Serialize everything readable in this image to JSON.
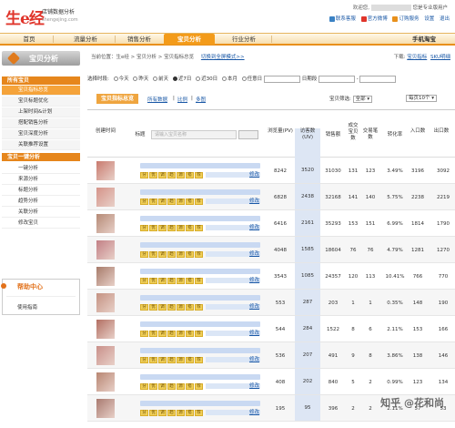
{
  "header": {
    "logo_main": "生e经",
    "logo_sub": "店铺数据分析",
    "logo_url": "shengejing.com",
    "greeting": "欢迎您,",
    "edition": "您是专业版用户",
    "links": [
      "联系客服",
      "官方微博",
      "订购服务",
      "设置",
      "退出"
    ]
  },
  "nav": [
    "首页",
    "流量分析",
    "销售分析",
    "宝贝分析",
    "行业分析",
    "手机淘宝"
  ],
  "nav_active": 3,
  "sidebar": {
    "title": "宝贝分析",
    "group1": "所有宝贝",
    "group1_items": [
      "宝贝指标总览",
      "宝贝标题优化",
      "上架时间&计划",
      "搭配销售分析",
      "宝贝深度分析",
      "关联推荐设置"
    ],
    "group2": "宝贝一键分析",
    "group2_items": [
      "一键分析",
      "来源分析",
      "标题分析",
      "趋势分析",
      "关联分析",
      "修改宝贝"
    ],
    "help_title": "帮助中心",
    "help_link": "使用指南"
  },
  "breadcrumb": {
    "text": "当前位置：生e经 > 宝贝分析 > 宝贝指标总览",
    "link": "切换到全屏模式>>",
    "right_prefix": "下载:",
    "right_link1": "宝贝指标",
    "right_link2": "SKU明细"
  },
  "filter": {
    "label": "选择时段:",
    "options": [
      "今天",
      "昨天",
      "前天",
      "近7日",
      "近30日",
      "本月",
      "任意日"
    ],
    "selected": 3,
    "date_label": "日期段"
  },
  "tabs": {
    "main": "宝贝指标总览",
    "links": [
      "所有数据",
      "比例",
      "多图"
    ],
    "filter_label": "宝贝筛选:",
    "filter_value": "全部",
    "per_page": "每页10个"
  },
  "table": {
    "headers": [
      "创建时间",
      "标题",
      "浏览量(PV)",
      "访客数(UV)",
      "销售额",
      "成交宝贝数",
      "交易笔数",
      "转化率",
      "入口数",
      "出口数"
    ],
    "search_placeholder": "请输入宝贝名称",
    "tags": [
      "分",
      "优",
      "调",
      "趋",
      "源",
      "搭",
      "荐"
    ],
    "edit_label": "修改",
    "rows": [
      [
        "8242",
        "3520",
        "31030",
        "131",
        "123",
        "3.49%",
        "3196",
        "3092"
      ],
      [
        "6828",
        "2438",
        "32168",
        "141",
        "140",
        "5.75%",
        "2238",
        "2219"
      ],
      [
        "6416",
        "2161",
        "35293",
        "153",
        "151",
        "6.99%",
        "1814",
        "1790"
      ],
      [
        "4048",
        "1585",
        "18604",
        "76",
        "76",
        "4.79%",
        "1281",
        "1270"
      ],
      [
        "3543",
        "1085",
        "24357",
        "120",
        "113",
        "10.41%",
        "766",
        "770"
      ],
      [
        "553",
        "287",
        "203",
        "1",
        "1",
        "0.35%",
        "148",
        "190"
      ],
      [
        "544",
        "284",
        "1522",
        "8",
        "6",
        "2.11%",
        "153",
        "166"
      ],
      [
        "536",
        "207",
        "491",
        "9",
        "8",
        "3.86%",
        "138",
        "146"
      ],
      [
        "408",
        "202",
        "840",
        "5",
        "2",
        "0.99%",
        "123",
        "134"
      ],
      [
        "195",
        "95",
        "396",
        "2",
        "2",
        "2.11%",
        "57",
        "53"
      ]
    ]
  },
  "watermark": {
    "text": "知乎 @花和尚"
  },
  "colors": {
    "accent": "#f39b1a",
    "brand_red": "#e0352b",
    "link": "#1a58a6"
  }
}
